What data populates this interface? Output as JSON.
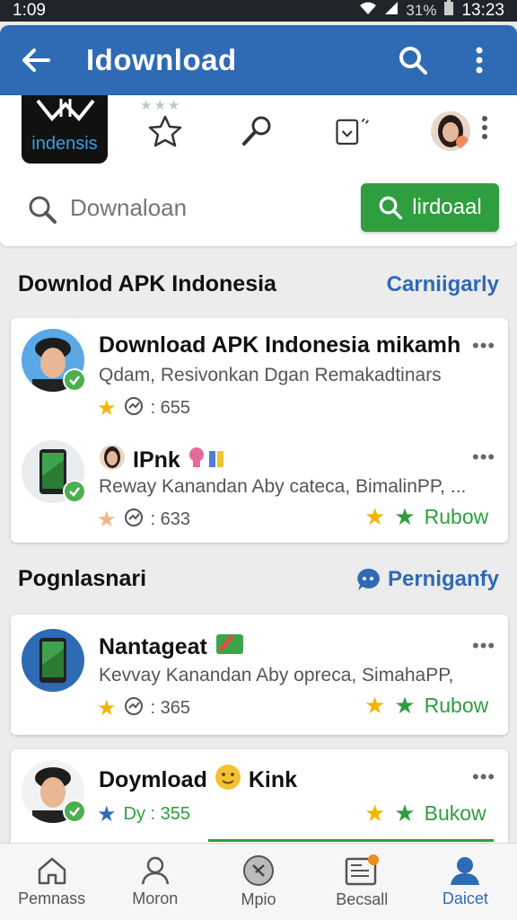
{
  "status_bar": {
    "time": "1:09",
    "battery": "31%",
    "clock": "13:23"
  },
  "app_bar": {
    "title": "Idownload"
  },
  "header": {
    "logo_text": "indensis",
    "search_placeholder": "Downaloan",
    "download_button": "lirdoaal"
  },
  "section1": {
    "title": "Downlod APK Indonesia",
    "link": "Carniigarly"
  },
  "section1_items": [
    {
      "name": "Download APK Indonesia mikamh",
      "desc": "Qdam, Resivonkan Dgan Remakadtinars",
      "stat": ": 655"
    },
    {
      "name": "IPnk",
      "desc": "Reway Kanandan Aby cateca,  BimalinPP, ...",
      "stat": ": 633",
      "action": "Rubow"
    }
  ],
  "section2": {
    "title": "Pognlasnari",
    "link": "Perniganfy"
  },
  "section2_items": [
    {
      "name": "Nantageat",
      "desc": "Kevvay Kanandan Aby opreca,  SimahaPP,",
      "stat": ": 365",
      "action": "Rubow"
    },
    {
      "name": "Doymload",
      "name2": "Kink",
      "stat": "Dy : 355",
      "action": "Bukow"
    }
  ],
  "bottom_nav": [
    {
      "label": "Pemnass"
    },
    {
      "label": "Moron"
    },
    {
      "label": "Mpio"
    },
    {
      "label": "Becsall"
    },
    {
      "label": "Daicet"
    }
  ],
  "colors": {
    "primary": "#2f6ab5",
    "accent_green": "#2e9e3e",
    "star": "#f5b400"
  }
}
